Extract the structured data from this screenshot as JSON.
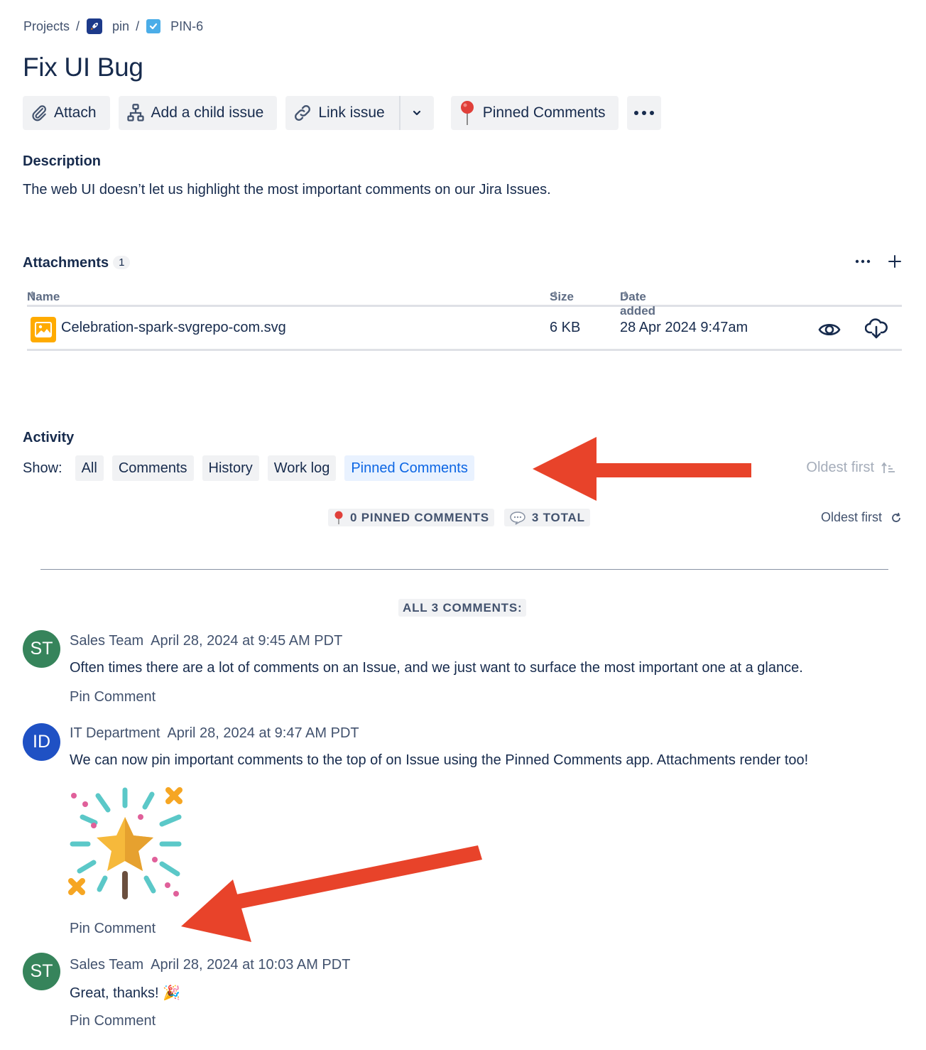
{
  "breadcrumb": {
    "projects": "Projects",
    "project_name": "pin",
    "issue_key": "PIN-6",
    "separator": "/"
  },
  "issue": {
    "title": "Fix UI Bug"
  },
  "toolbar": {
    "attach": "Attach",
    "add_child": "Add a child issue",
    "link_issue": "Link issue",
    "pinned_comments": "Pinned Comments"
  },
  "description": {
    "heading": "Description",
    "text": "The web UI doesn’t let us highlight the most important comments on our Jira Issues."
  },
  "attachments": {
    "heading": "Attachments",
    "count": "1",
    "columns": {
      "name": "Name",
      "size": "Size",
      "date_added": "Date added"
    },
    "rows": [
      {
        "name": "Celebration-spark-svgrepo-com.svg",
        "size": "6 KB",
        "date": "28 Apr 2024 9:47am"
      }
    ]
  },
  "activity": {
    "heading": "Activity",
    "show_label": "Show:",
    "filters": [
      "All",
      "Comments",
      "History",
      "Work log",
      "Pinned Comments"
    ],
    "active_filter": "Pinned Comments",
    "sort_label": "Oldest first"
  },
  "pinned_app": {
    "pinned_count": "0 PINNED COMMENTS",
    "total_count": "3 TOTAL",
    "sort_label": "Oldest first",
    "all_comments_label": "ALL 3 COMMENTS:",
    "pin_action": "Pin Comment",
    "comments": [
      {
        "initials": "ST",
        "author": "Sales Team",
        "timestamp": "April 28, 2024 at 9:45 AM PDT",
        "body": "Often times there are a lot of comments on an Issue, and we just want to surface the most important one at a glance.",
        "avatar_color": "#36845b"
      },
      {
        "initials": "ID",
        "author": "IT Department",
        "timestamp": "April 28, 2024 at 9:47 AM PDT",
        "body": "We can now pin important comments to the top of on Issue using the Pinned Comments app. Attachments render too!",
        "avatar_color": "#1f51c4"
      },
      {
        "initials": "ST",
        "author": "Sales Team",
        "timestamp": "April 28, 2024 at 10:03 AM PDT",
        "body": "Great, thanks! 🎉",
        "avatar_color": "#36845b"
      }
    ]
  },
  "colors": {
    "annotation_arrow": "#e8432a",
    "active_filter_bg": "#e9f2ff",
    "active_filter_text": "#0c66e4"
  }
}
